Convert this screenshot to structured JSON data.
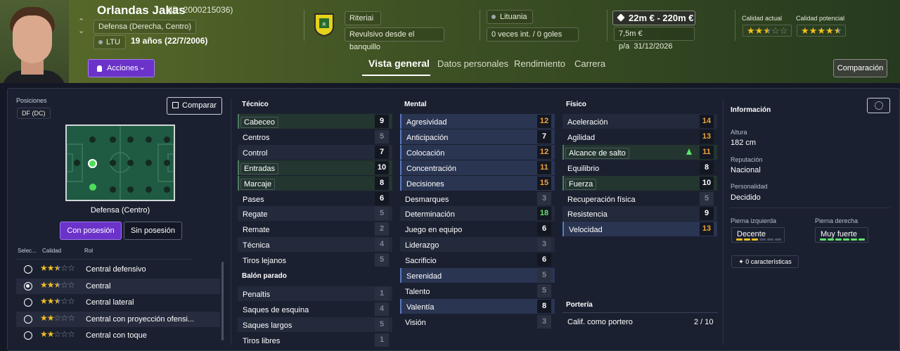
{
  "player": {
    "name": "Orlandas Jakas",
    "id": "(ID: 2000215036)",
    "position": "Defensa (Derecha, Centro)",
    "nation_code": "LTU",
    "age": "19 años (22/7/2006)"
  },
  "actions_label": "Acciones",
  "club": {
    "name": "Riteriai",
    "role": "Revulsivo desde el banquillo"
  },
  "nation": {
    "name": "Lituania",
    "caps": "0 veces int. / 0 goles"
  },
  "value": {
    "range": "22m € - 220m €",
    "wage": "7,5m € p/a",
    "contract": "31/12/2026"
  },
  "quality": {
    "current_label": "Calidad actual",
    "current_stars": 2.5,
    "potential_label": "Calidad potencial",
    "potential_stars": 4.5
  },
  "tabs": [
    "Vista general",
    "Datos personales",
    "Rendimiento",
    "Carrera"
  ],
  "compare_header_btn": "Comparación",
  "left": {
    "positions_label": "Posiciones",
    "position_tag": "DF (DC)",
    "compare_btn": "Comparar",
    "pitch_caption": "Defensa (Centro)",
    "toggle": [
      "Con posesión",
      "Sin posesión"
    ],
    "role_headers": [
      "Selec...",
      "Calidad",
      "Rol"
    ],
    "roles": [
      {
        "name": "Central defensivo",
        "stars": 2.5,
        "selected": false
      },
      {
        "name": "Central",
        "stars": 2.5,
        "selected": true
      },
      {
        "name": "Central lateral",
        "stars": 2.5,
        "selected": false
      },
      {
        "name": "Central con proyección ofensi...",
        "stars": 2,
        "selected": false
      },
      {
        "name": "Central con toque",
        "stars": 2,
        "selected": false
      }
    ]
  },
  "tecnico": {
    "title": "Técnico",
    "items": [
      [
        "Cabeceo",
        9,
        "hl"
      ],
      [
        "Centros",
        5,
        ""
      ],
      [
        "Control",
        7,
        ""
      ],
      [
        "Entradas",
        10,
        "hl"
      ],
      [
        "Marcaje",
        8,
        "hl"
      ],
      [
        "Pases",
        6,
        ""
      ],
      [
        "Regate",
        5,
        ""
      ],
      [
        "Remate",
        2,
        ""
      ],
      [
        "Técnica",
        4,
        ""
      ],
      [
        "Tiros lejanos",
        5,
        ""
      ]
    ]
  },
  "balon": {
    "title": "Balón parado",
    "items": [
      [
        "Penaltis",
        1,
        ""
      ],
      [
        "Saques de esquina",
        4,
        ""
      ],
      [
        "Saques largos",
        5,
        ""
      ],
      [
        "Tiros libres",
        1,
        ""
      ]
    ]
  },
  "mental": {
    "title": "Mental",
    "items": [
      [
        "Agresividad",
        12,
        "blue"
      ],
      [
        "Anticipación",
        7,
        "blue"
      ],
      [
        "Colocación",
        12,
        "blue"
      ],
      [
        "Concentración",
        11,
        "blue"
      ],
      [
        "Decisiones",
        15,
        "blue"
      ],
      [
        "Desmarques",
        3,
        ""
      ],
      [
        "Determinación",
        18,
        ""
      ],
      [
        "Juego en equipo",
        6,
        ""
      ],
      [
        "Liderazgo",
        3,
        ""
      ],
      [
        "Sacrificio",
        6,
        ""
      ],
      [
        "Serenidad",
        5,
        "blue"
      ],
      [
        "Talento",
        5,
        ""
      ],
      [
        "Valentía",
        8,
        "blue"
      ],
      [
        "Visión",
        3,
        ""
      ]
    ]
  },
  "fisico": {
    "title": "Físico",
    "items": [
      [
        "Aceleración",
        14,
        ""
      ],
      [
        "Agilidad",
        13,
        ""
      ],
      [
        "Alcance de salto",
        11,
        "hl"
      ],
      [
        "Equilibrio",
        8,
        ""
      ],
      [
        "Fuerza",
        10,
        "hl"
      ],
      [
        "Recuperación física",
        5,
        ""
      ],
      [
        "Resistencia",
        9,
        ""
      ],
      [
        "Velocidad",
        13,
        "blue"
      ]
    ]
  },
  "porteria": {
    "title": "Portería",
    "label": "Calif. como portero",
    "value": "2 / 10"
  },
  "info": {
    "title": "Información",
    "height_label": "Altura",
    "height": "182 cm",
    "rep_label": "Reputación",
    "rep": "Nacional",
    "pers_label": "Personalidad",
    "pers": "Decidido",
    "lf_label": "Pierna izquierda",
    "lf": "Decente",
    "lf_level": 3,
    "rf_label": "Pierna derecha",
    "rf": "Muy fuerte",
    "rf_level": 5,
    "traits": "0 características"
  },
  "colors": {
    "accent": "#6b33c9",
    "star": "#f0c020",
    "green": "#5fe36a",
    "orange": "#f0a53a"
  }
}
